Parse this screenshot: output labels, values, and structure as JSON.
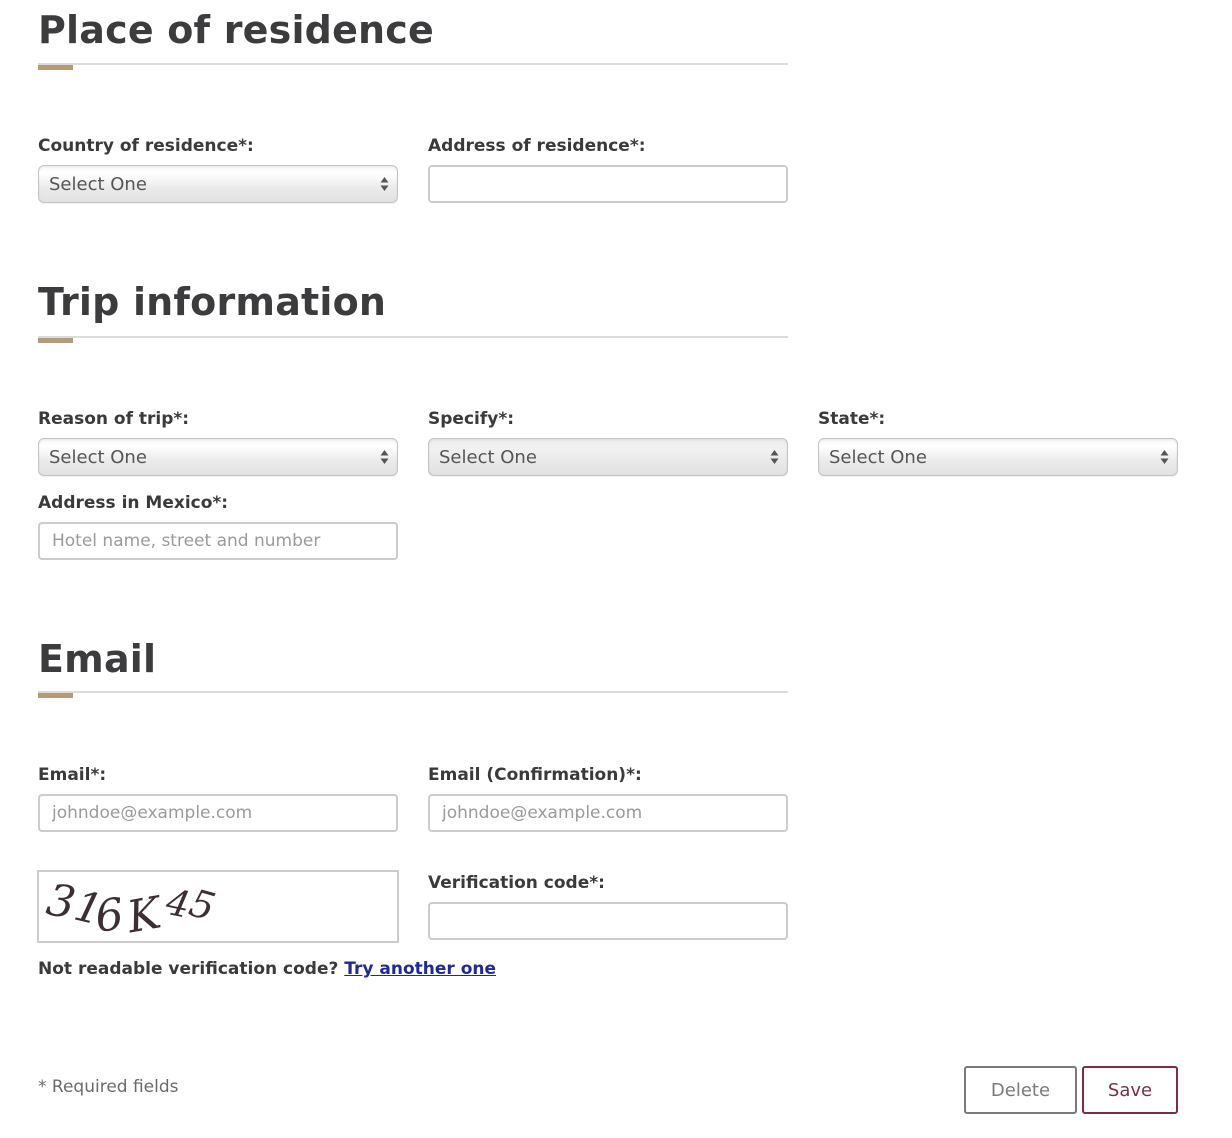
{
  "sections": {
    "residence": {
      "title": "Place of residence",
      "country_label": "Country of residence*:",
      "country_value": "Select One",
      "address_label": "Address of residence*:",
      "address_value": ""
    },
    "trip": {
      "title": "Trip information",
      "reason_label": "Reason of trip*:",
      "reason_value": "Select One",
      "specify_label": "Specify*:",
      "specify_value": "Select One",
      "state_label": "State*:",
      "state_value": "Select One",
      "address_mexico_label": "Address in Mexico*:",
      "address_mexico_placeholder": "Hotel name, street and number"
    },
    "email": {
      "title": "Email",
      "email_label": "Email*:",
      "email_placeholder": "johndoe@example.com",
      "email_confirm_label": "Email (Confirmation)*:",
      "email_confirm_placeholder": "johndoe@example.com",
      "captcha_text": "316K45",
      "verification_label": "Verification code*:",
      "verification_value": "",
      "captcha_help_text": "Not readable verification code?",
      "captcha_help_link": "Try another one"
    }
  },
  "footer": {
    "required_note": "* Required fields",
    "delete_label": "Delete",
    "save_label": "Save"
  },
  "colors": {
    "accent": "#b39b77",
    "save": "#7a2e45",
    "link": "#1f2a8c"
  }
}
